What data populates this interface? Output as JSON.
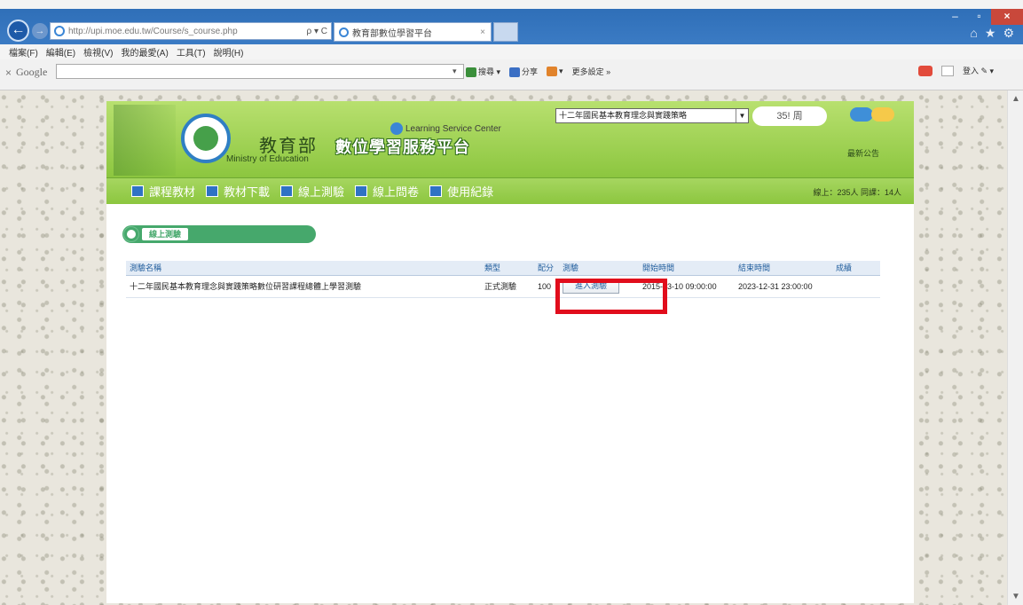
{
  "browser": {
    "address_url": "http://upi.moe.edu.tw/Course/s_course.php",
    "address_tools": "ρ ▾ C",
    "tab_title": "教育部數位學習平台",
    "tab_close": "×",
    "window_controls": [
      "–",
      "▫",
      "×"
    ],
    "right_icons": [
      "⌂",
      "★",
      "⚙"
    ],
    "menu": [
      "檔案(F)",
      "編輯(E)",
      "檢視(V)",
      "我的最愛(A)",
      "工具(T)",
      "說明(H)"
    ]
  },
  "googlebar": {
    "close": "×",
    "label": "Google",
    "tools": [
      "搜尋 ▾",
      "分享",
      "▾",
      "更多設定 »"
    ],
    "signin": "登入 ✎ ▾"
  },
  "site": {
    "learning_center": "Learning Service Center",
    "moe_title": "教育部",
    "moe_en": "Ministry of Education",
    "platform_title": "數位學習服務平台",
    "course_select": "十二年國民基本教育理念與實踐策略",
    "week": "35! 周",
    "announcement": "最新公告",
    "online": "線上：235人 同課：14人"
  },
  "nav": {
    "items": [
      "課程教材",
      "教材下載",
      "線上測驗",
      "線上問卷",
      "使用紀錄"
    ]
  },
  "section": {
    "title": "線上測驗"
  },
  "table": {
    "headers": [
      "測驗名稱",
      "類型",
      "配分",
      "測驗",
      "開始時間",
      "結束時間",
      "成績"
    ],
    "rows": [
      {
        "name": "十二年國民基本教育理念與實踐策略數位研習課程總體上學習測驗",
        "type": "正式測驗",
        "score": "100",
        "action": "進入測驗",
        "start": "2015-03-10 09:00:00",
        "end": "2023-12-31 23:00:00",
        "grade": ""
      }
    ]
  },
  "colors": {
    "header_green": "#8cc63f",
    "section_green": "#46a86c",
    "link_blue": "#1f5c9c",
    "highlight_red": "#e10d1c"
  }
}
